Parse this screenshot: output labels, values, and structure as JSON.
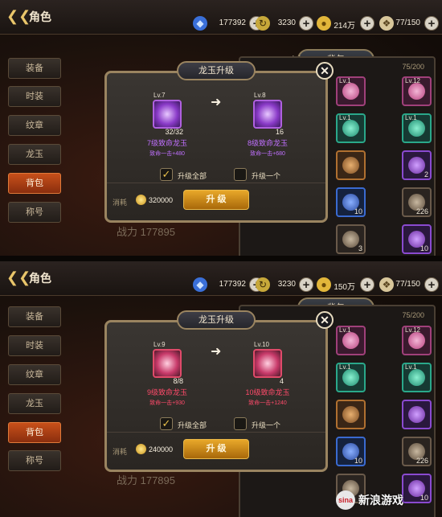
{
  "panels": [
    {
      "header": {
        "title": "角色",
        "gems": "177392",
        "horns": "3230",
        "coins": "214万",
        "energy": "77/150"
      },
      "menu": [
        "装备",
        "时装",
        "纹章",
        "龙玉",
        "背包",
        "称号"
      ],
      "active_menu": 4,
      "bag_tab": "背包",
      "player_tab": "玩家每日",
      "inventory_count": "75/200",
      "power": "战力 177895",
      "dialog": {
        "title": "龙玉升级",
        "from": {
          "level": "Lv.7",
          "count": "32/32",
          "name": "7级致命龙玉",
          "effect": "致命一击+480"
        },
        "to": {
          "level": "Lv.8",
          "count": "16",
          "name": "8级致命龙玉",
          "effect": "致命一击+680"
        },
        "option_all": "升级全部",
        "option_one": "升级一个",
        "cost_label": "消耗",
        "cost": "320000",
        "upgrade_label": "升 级"
      },
      "slots": [
        [
          "Lv.1",
          "",
          "pink"
        ],
        [
          "Lv.12",
          "",
          "pink"
        ],
        [
          "Lv.1",
          "",
          "teal"
        ],
        [
          "Lv.1",
          "",
          "teal"
        ],
        [
          "",
          "",
          "orange"
        ],
        [
          "",
          "2",
          "purple"
        ],
        [
          "",
          "10",
          "blue"
        ],
        [
          "",
          "226",
          "gray"
        ],
        [
          "",
          "3",
          "gray"
        ],
        [
          "",
          "10",
          "purple"
        ]
      ]
    },
    {
      "header": {
        "title": "角色",
        "gems": "177392",
        "horns": "3230",
        "coins": "150万",
        "energy": "77/150"
      },
      "menu": [
        "装备",
        "时装",
        "纹章",
        "龙玉",
        "背包",
        "称号"
      ],
      "active_menu": 4,
      "bag_tab": "背包",
      "player_tab": "",
      "inventory_count": "75/200",
      "power": "战力 177895",
      "dialog": {
        "title": "龙玉升级",
        "from": {
          "level": "Lv.9",
          "count": "8/8",
          "name": "9级致命龙玉",
          "effect": "致命一击+930"
        },
        "to": {
          "level": "Lv.10",
          "count": "4",
          "name": "10级致命龙玉",
          "effect": "致命一击+1240"
        },
        "option_all": "升级全部",
        "option_one": "升级一个",
        "cost_label": "消耗",
        "cost": "240000",
        "upgrade_label": "升 级"
      },
      "slots": [
        [
          "Lv.1",
          "",
          "pink"
        ],
        [
          "Lv.12",
          "",
          "pink"
        ],
        [
          "Lv.1",
          "",
          "teal"
        ],
        [
          "Lv.1",
          "",
          "teal"
        ],
        [
          "",
          "",
          "orange"
        ],
        [
          "",
          "",
          "purple"
        ],
        [
          "",
          "10",
          "blue"
        ],
        [
          "",
          "226",
          "gray"
        ],
        [
          "",
          "3",
          "gray"
        ],
        [
          "",
          "10",
          "purple"
        ]
      ]
    }
  ],
  "watermark": {
    "logo": "sina",
    "text": "新浪游戏"
  }
}
